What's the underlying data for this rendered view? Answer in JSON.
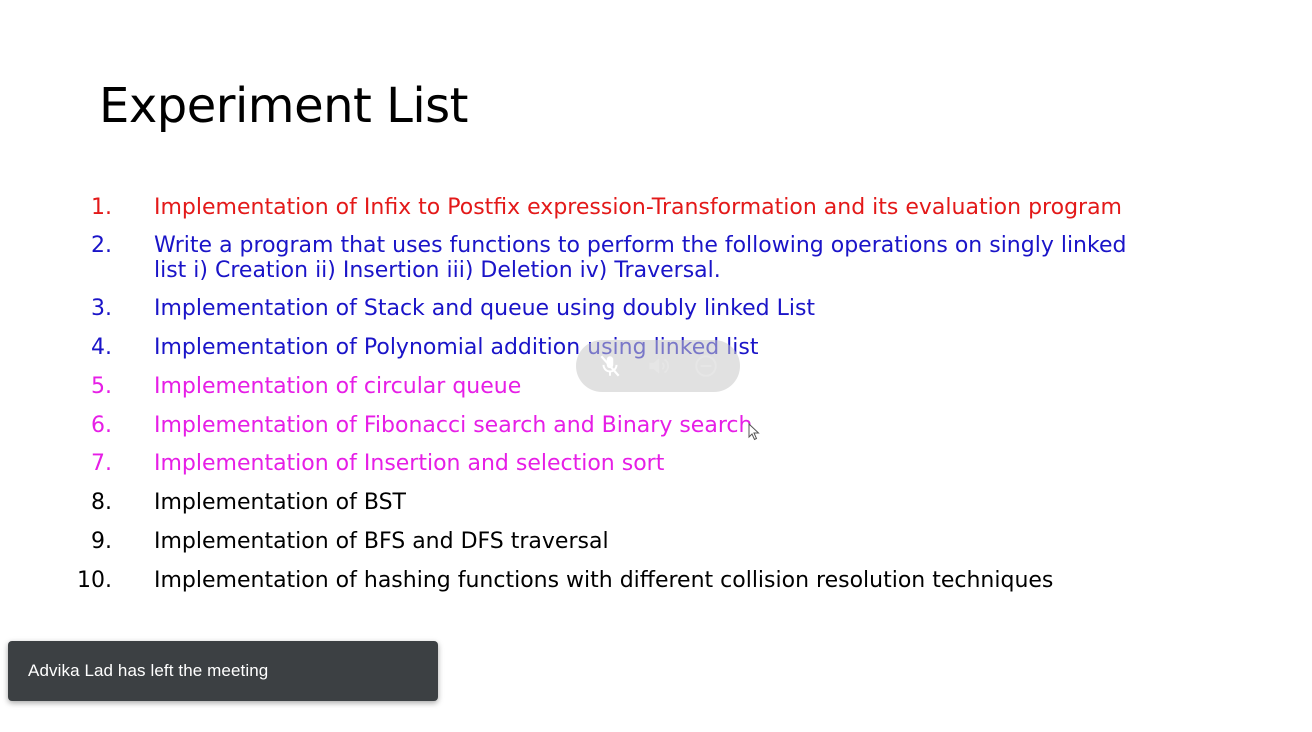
{
  "slide": {
    "title": "Experiment List",
    "items": [
      {
        "number": "1.",
        "text": "Implementation of Infix to Postfix expression-Transformation and its evaluation program",
        "color": "#e31919"
      },
      {
        "number": "2.",
        "text": "Write a program that uses functions to perform the following operations on singly linked",
        "text_line2": "list i) Creation ii) Insertion iii) Deletion iv) Traversal.",
        "color": "#1a14c8"
      },
      {
        "number": "3.",
        "text": "Implementation of Stack and queue using doubly linked List",
        "color": "#1a14c8"
      },
      {
        "number": "4.",
        "text": "Implementation of Polynomial addition using linked list",
        "color": "#1a14c8"
      },
      {
        "number": "5.",
        "text": "Implementation of circular queue",
        "color": "#e61ee6"
      },
      {
        "number": "6.",
        "text": "Implementation of Fibonacci search and Binary search",
        "color": "#e61ee6"
      },
      {
        "number": "7.",
        "text": "Implementation of Insertion and selection sort",
        "color": "#e61ee6"
      },
      {
        "number": "8.",
        "text": "Implementation of BST",
        "color": "#000000"
      },
      {
        "number": "9.",
        "text": "Implementation of BFS and DFS traversal",
        "color": "#000000"
      },
      {
        "number": "10.",
        "text": "Implementation of hashing functions with different collision resolution techniques",
        "color": "#000000"
      }
    ]
  },
  "overlay": {
    "icons": [
      "mic-off-icon",
      "speaker-icon",
      "minus-circle-icon"
    ]
  },
  "toast": {
    "message": "Advika Lad has left the meeting"
  },
  "colors": {
    "toast_bg": "#3c4043",
    "overlay_bg": "#c8c8c8"
  }
}
